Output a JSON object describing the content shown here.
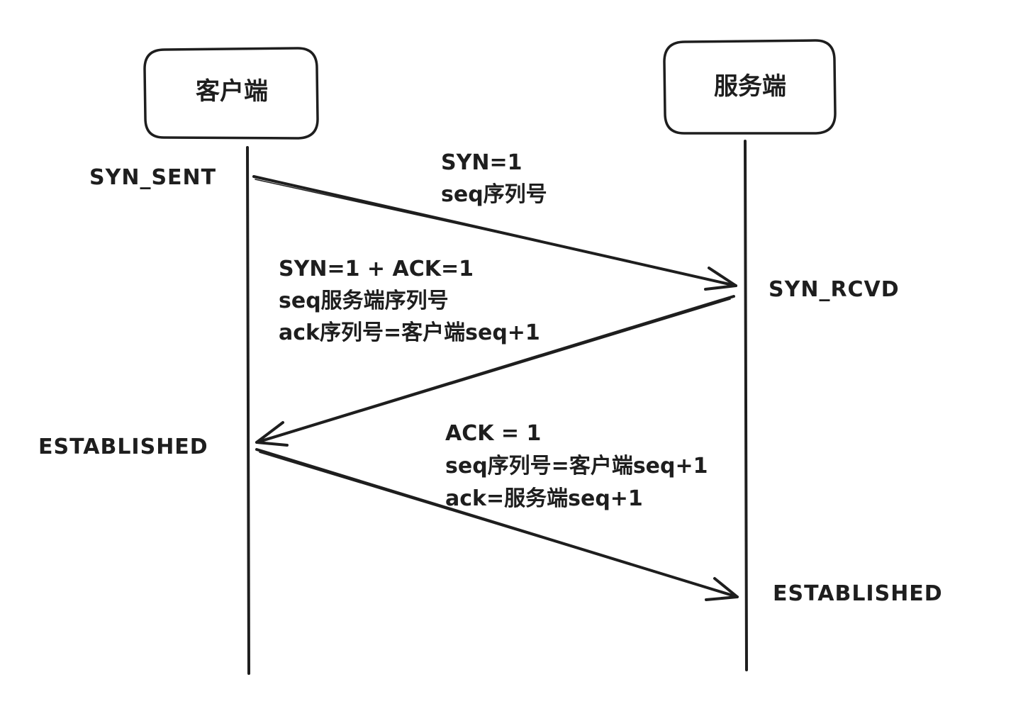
{
  "diagram": {
    "nodes": {
      "client": "客户端",
      "server": "服务端"
    },
    "states": {
      "client_syn_sent": "SYN_SENT",
      "server_syn_rcvd": "SYN_RCVD",
      "client_established": "ESTABLISHED",
      "server_established": "ESTABLISHED"
    },
    "messages": {
      "syn": {
        "line1": "SYN=1",
        "line2": "seq序列号"
      },
      "syn_ack": {
        "line1": "SYN=1 + ACK=1",
        "line2": "seq服务端序列号",
        "line3": "ack序列号=客户端seq+1"
      },
      "ack": {
        "line1": "ACK = 1",
        "line2": "seq序列号=客户端seq+1",
        "line3": "ack=服务端seq+1"
      }
    }
  }
}
